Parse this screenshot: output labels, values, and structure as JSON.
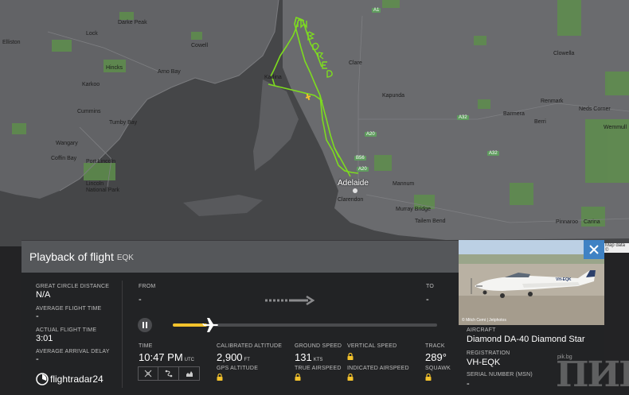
{
  "map": {
    "places": {
      "darke_peak": "Darke Peak",
      "lock": "Lock",
      "cowell": "Cowell",
      "elliston": "Elliston",
      "hincks": "Hincks",
      "arno_bay": "Arno Bay",
      "kadina": "Kadina",
      "clare": "Clare",
      "clowella": "Clowella",
      "kapunda": "Kapunda",
      "renmark": "Renmark",
      "barmera": "Barmera",
      "berri": "Berri",
      "neds_corner": "Neds Corner",
      "wemmull": "Wemmull",
      "karkoo": "Karkoo",
      "tumby_bay": "Tumby Bay",
      "cummins": "Cummins",
      "wangary": "Wangary",
      "coffin_bay": "Coffin Bay",
      "port_lincoln": "Port Lincoln",
      "lincoln_np": "Lincoln\nNational Park",
      "adelaide": "Adelaide",
      "clarendon": "Clarendon",
      "mannum": "Mannum",
      "murray_bridge": "Murray Bridge",
      "tailem_bend": "Tailem Bend",
      "pinnaroo": "Pinnaroo",
      "carina": "Carina"
    },
    "roads": [
      "A1",
      "A32",
      "A20",
      "A32",
      "B56",
      "A20"
    ],
    "skywriting": "I'M BORED",
    "attribution": "Map data ©"
  },
  "panel": {
    "title": "Playback of flight",
    "callsign": "EQK",
    "left": {
      "great_circle_label": "GREAT CIRCLE DISTANCE",
      "great_circle_value": "N/A",
      "avg_flight_time_label": "AVERAGE FLIGHT TIME",
      "avg_flight_time_value": "-",
      "actual_flight_time_label": "ACTUAL FLIGHT TIME",
      "actual_flight_time_value": "3:01",
      "avg_arrival_delay_label": "AVERAGE ARRIVAL DELAY",
      "avg_arrival_delay_value": "-"
    },
    "route": {
      "from_label": "FROM",
      "from_value": "-",
      "to_label": "TO",
      "to_value": "-"
    },
    "playback": {
      "progress": 0.13
    },
    "stats": {
      "time_label": "TIME",
      "time_value": "10:47 PM",
      "time_unit": "UTC",
      "cal_alt_label": "CALIBRATED ALTITUDE",
      "cal_alt_value": "2,900",
      "cal_alt_unit": "FT",
      "gps_alt_label": "GPS ALTITUDE",
      "ground_speed_label": "GROUND SPEED",
      "ground_speed_value": "131",
      "ground_speed_unit": "KTS",
      "true_airspeed_label": "TRUE AIRSPEED",
      "vertical_speed_label": "VERTICAL SPEED",
      "indicated_airspeed_label": "INDICATED AIRSPEED",
      "track_label": "TRACK",
      "track_value": "289°",
      "squawk_label": "SQUAWK"
    },
    "brand": "flightradar24"
  },
  "aircraft": {
    "photo_credit": "© Mitch Cemi | Jetphotos",
    "aircraft_label": "AIRCRAFT",
    "aircraft_value": "Diamond DA-40 Diamond Star",
    "registration_label": "REGISTRATION",
    "registration_value": "VH-EQK",
    "serial_label": "SERIAL NUMBER (MSN)",
    "serial_value": "-",
    "tail_mark": "VH-EQK"
  },
  "watermark": "ПИК",
  "watermark_site": "pik.bg",
  "colors": {
    "track_green": "#7ddc1f",
    "progress_yellow": "#f3c22c",
    "close_blue": "#3f82c4",
    "lock_yellow": "#f3c22c"
  }
}
